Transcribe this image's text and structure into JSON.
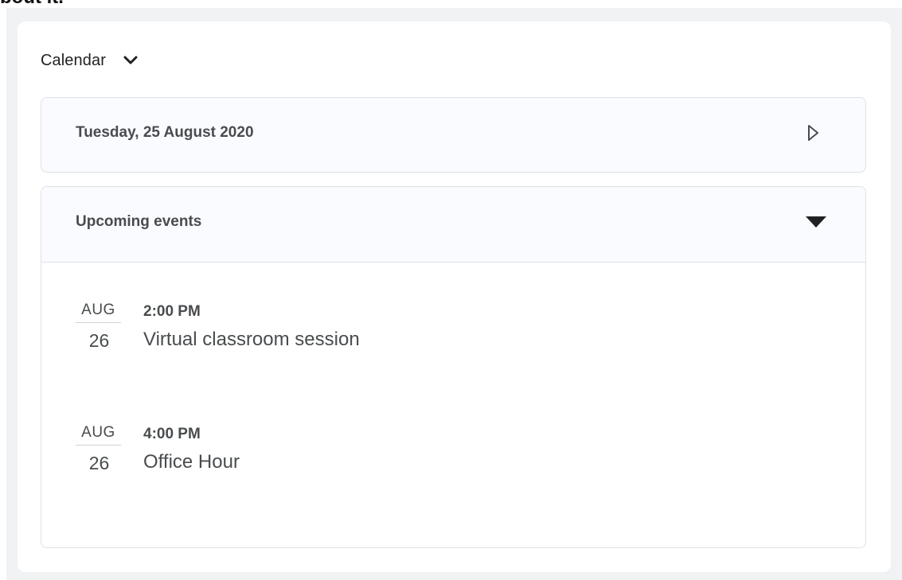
{
  "top_fragment": "bout it.",
  "widget": {
    "title": "Calendar"
  },
  "date_panel": {
    "date": "Tuesday, 25 August 2020"
  },
  "events_panel": {
    "title": "Upcoming events",
    "events": [
      {
        "month": "AUG",
        "day": "26",
        "time": "2:00 PM",
        "name": "Virtual classroom session"
      },
      {
        "month": "AUG",
        "day": "26",
        "time": "4:00 PM",
        "name": "Office Hour"
      }
    ]
  },
  "icons": {
    "widget_menu": "chevron-down-icon",
    "next_day": "play-outline-icon",
    "collapse": "caret-down-icon"
  },
  "colors": {
    "page_background": "#f1f2f4",
    "card_background": "#ffffff",
    "panel_header_background": "#f9fbff",
    "border": "#dfe1e5",
    "text": "#494c4e"
  }
}
